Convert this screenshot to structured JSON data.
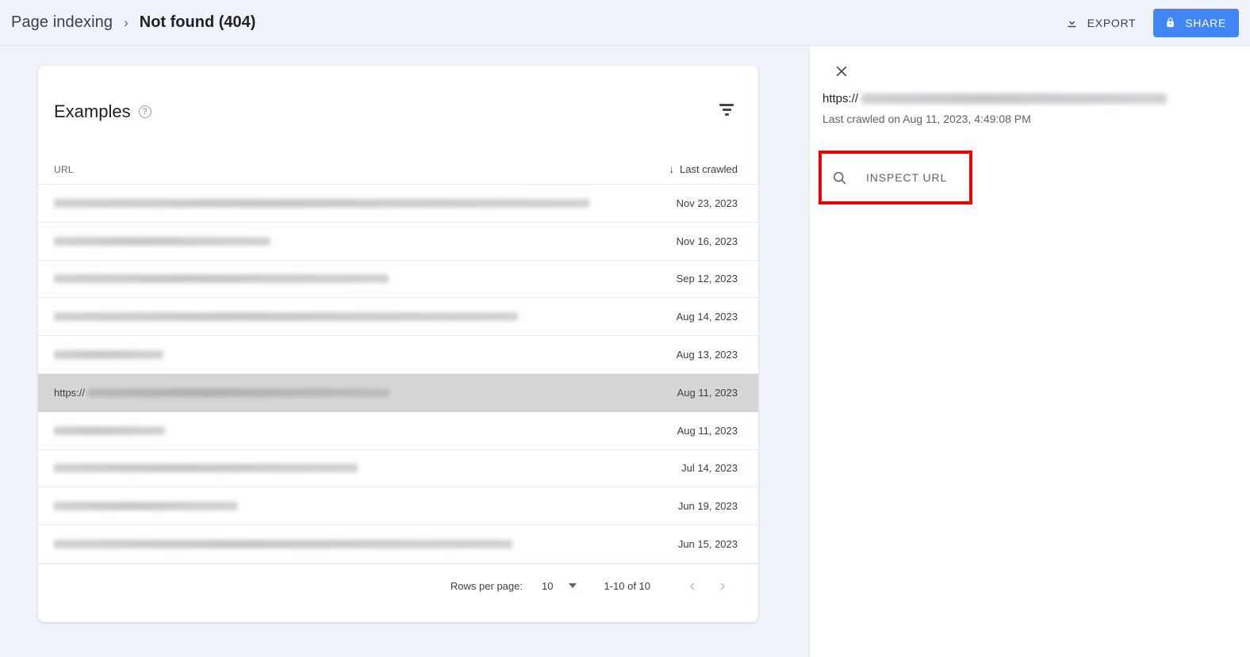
{
  "breadcrumb": {
    "parent": "Page indexing",
    "separator": "›",
    "current": "Not found (404)"
  },
  "topbar": {
    "export_label": "EXPORT",
    "share_label": "SHARE",
    "share_color": "#4285f4"
  },
  "card": {
    "title": "Examples",
    "help_glyph": "?",
    "columns": {
      "url": "URL",
      "last_crawled": "Last crawled",
      "sort_arrow": "↓"
    },
    "rows": [
      {
        "scheme": "",
        "redacted_width": 675,
        "date": "Nov 23, 2023",
        "selected": false
      },
      {
        "scheme": "",
        "redacted_width": 273,
        "date": "Nov 16, 2023",
        "selected": false
      },
      {
        "scheme": "",
        "redacted_width": 422,
        "date": "Sep 12, 2023",
        "selected": false
      },
      {
        "scheme": "",
        "redacted_width": 585,
        "date": "Aug 14, 2023",
        "selected": false
      },
      {
        "scheme": "",
        "redacted_width": 138,
        "date": "Aug 13, 2023",
        "selected": false
      },
      {
        "scheme": "https://",
        "redacted_width": 381,
        "date": "Aug 11, 2023",
        "selected": true
      },
      {
        "scheme": "",
        "redacted_width": 140,
        "date": "Aug 11, 2023",
        "selected": false
      },
      {
        "scheme": "",
        "redacted_width": 383,
        "date": "Jul 14, 2023",
        "selected": false
      },
      {
        "scheme": "",
        "redacted_width": 232,
        "date": "Jun 19, 2023",
        "selected": false
      },
      {
        "scheme": "",
        "redacted_width": 578,
        "date": "Jun 15, 2023",
        "selected": false
      }
    ],
    "footer": {
      "rows_per_page_label": "Rows per page:",
      "rows_per_page_value": "10",
      "range": "1-10 of 10",
      "prev_glyph": "‹",
      "next_glyph": "›"
    }
  },
  "panel": {
    "url_scheme": "https://",
    "url_redacted_width": 385,
    "last_crawled": "Last crawled on Aug 11, 2023, 4:49:08 PM",
    "inspect_label": "INSPECT URL",
    "highlight_color": "#ee0000"
  }
}
